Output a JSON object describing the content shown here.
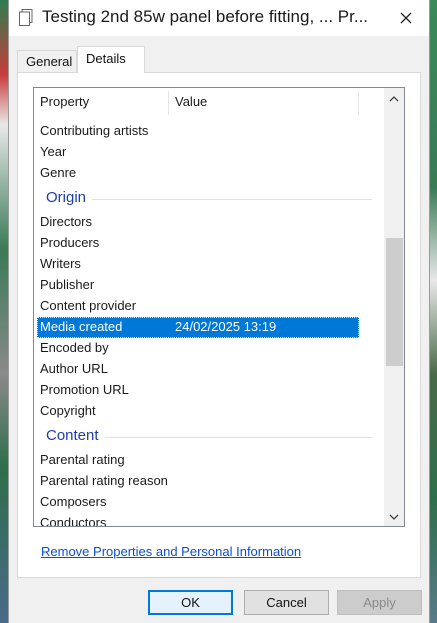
{
  "window": {
    "title": "Testing 2nd 85w panel before fitting, ... Pr..."
  },
  "tabs": {
    "general": "General",
    "details": "Details"
  },
  "columns": {
    "property": "Property",
    "value": "Value"
  },
  "rows": [
    {
      "property": "Contributing artists",
      "value": ""
    },
    {
      "property": "Year",
      "value": ""
    },
    {
      "property": "Genre",
      "value": ""
    },
    {
      "group": "Origin"
    },
    {
      "property": "Directors",
      "value": ""
    },
    {
      "property": "Producers",
      "value": ""
    },
    {
      "property": "Writers",
      "value": ""
    },
    {
      "property": "Publisher",
      "value": ""
    },
    {
      "property": "Content provider",
      "value": ""
    },
    {
      "property": "Media created",
      "value": "24/02/2025 13:19",
      "selected": true
    },
    {
      "property": "Encoded by",
      "value": ""
    },
    {
      "property": "Author URL",
      "value": ""
    },
    {
      "property": "Promotion URL",
      "value": ""
    },
    {
      "property": "Copyright",
      "value": ""
    },
    {
      "group": "Content"
    },
    {
      "property": "Parental rating",
      "value": ""
    },
    {
      "property": "Parental rating reason",
      "value": ""
    },
    {
      "property": "Composers",
      "value": ""
    },
    {
      "property": "Conductors",
      "value": ""
    }
  ],
  "links": {
    "remove": "Remove Properties and Personal Information"
  },
  "buttons": {
    "ok": "OK",
    "cancel": "Cancel",
    "apply": "Apply"
  },
  "icons": {
    "title": "file-properties-icon",
    "close": "close-icon",
    "up": "chevron-up-icon",
    "down": "chevron-down-icon"
  },
  "colors": {
    "selection": "#0078d7",
    "group_heading": "#1e3ea6",
    "link": "#0b4fd1"
  }
}
